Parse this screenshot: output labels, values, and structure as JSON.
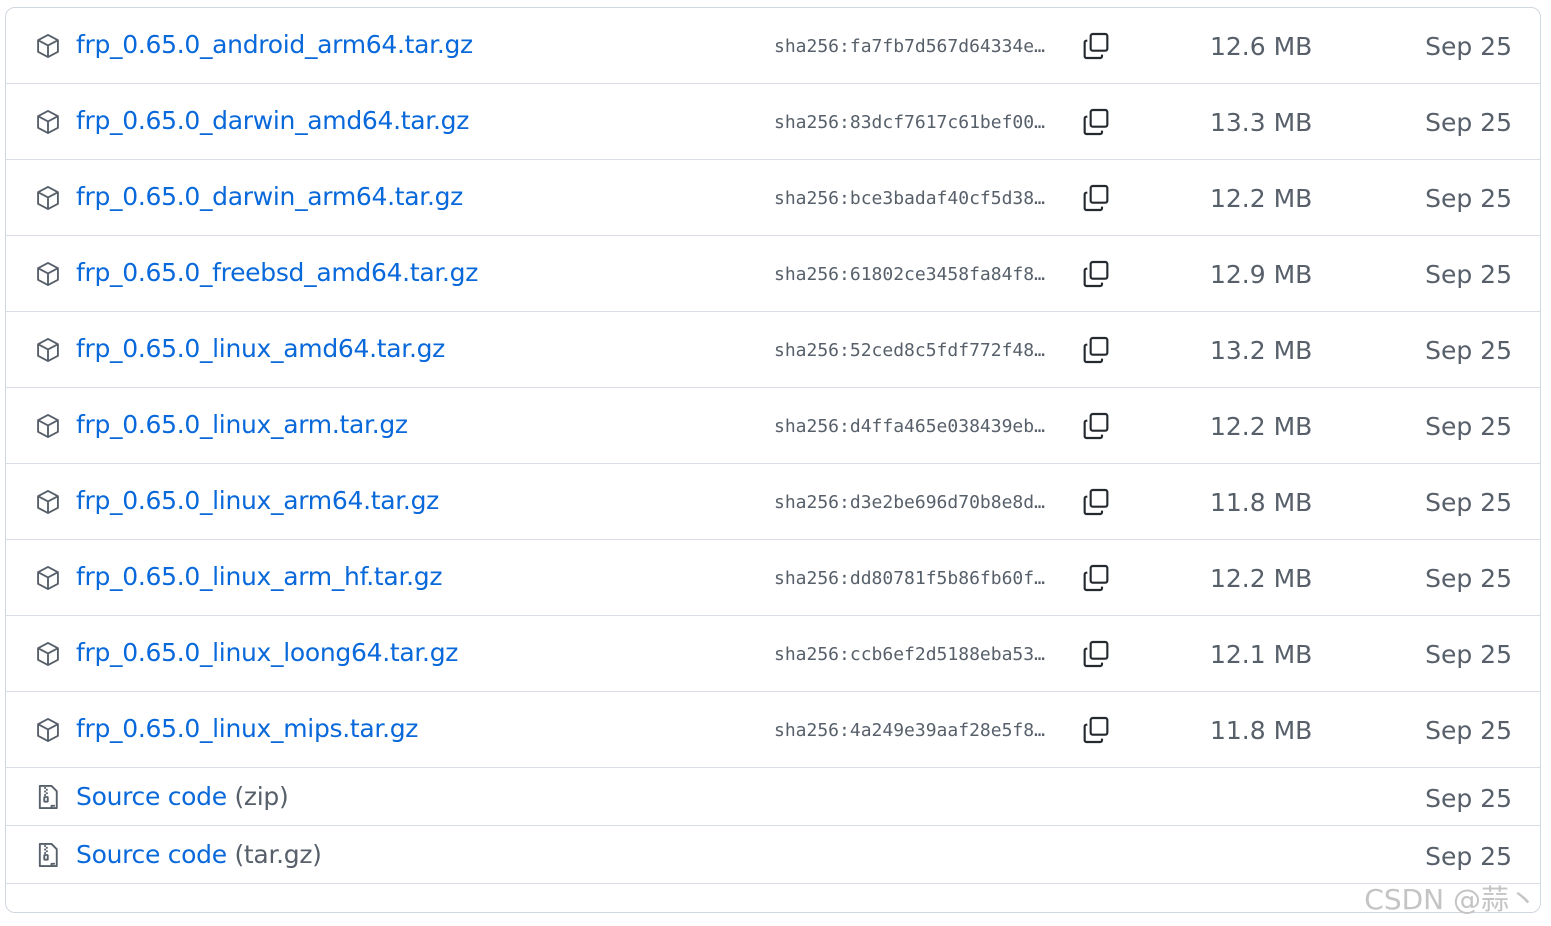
{
  "assets": [
    {
      "name": "frp_0.65.0_android_arm64.tar.gz",
      "digest": "sha256:fa7fb7d567d64334e…",
      "size": "12.6 MB",
      "date": "Sep 25"
    },
    {
      "name": "frp_0.65.0_darwin_amd64.tar.gz",
      "digest": "sha256:83dcf7617c61bef00…",
      "size": "13.3 MB",
      "date": "Sep 25"
    },
    {
      "name": "frp_0.65.0_darwin_arm64.tar.gz",
      "digest": "sha256:bce3badaf40cf5d38…",
      "size": "12.2 MB",
      "date": "Sep 25"
    },
    {
      "name": "frp_0.65.0_freebsd_amd64.tar.gz",
      "digest": "sha256:61802ce3458fa84f8…",
      "size": "12.9 MB",
      "date": "Sep 25"
    },
    {
      "name": "frp_0.65.0_linux_amd64.tar.gz",
      "digest": "sha256:52ced8c5fdf772f48…",
      "size": "13.2 MB",
      "date": "Sep 25"
    },
    {
      "name": "frp_0.65.0_linux_arm.tar.gz",
      "digest": "sha256:d4ffa465e038439eb…",
      "size": "12.2 MB",
      "date": "Sep 25"
    },
    {
      "name": "frp_0.65.0_linux_arm64.tar.gz",
      "digest": "sha256:d3e2be696d70b8e8d…",
      "size": "11.8 MB",
      "date": "Sep 25"
    },
    {
      "name": "frp_0.65.0_linux_arm_hf.tar.gz",
      "digest": "sha256:dd80781f5b86fb60f…",
      "size": "12.2 MB",
      "date": "Sep 25"
    },
    {
      "name": "frp_0.65.0_linux_loong64.tar.gz",
      "digest": "sha256:ccb6ef2d5188eba53…",
      "size": "12.1 MB",
      "date": "Sep 25"
    },
    {
      "name": "frp_0.65.0_linux_mips.tar.gz",
      "digest": "sha256:4a249e39aaf28e5f8…",
      "size": "11.8 MB",
      "date": "Sep 25"
    }
  ],
  "source_code": [
    {
      "label": "Source code",
      "suffix": "(zip)",
      "date": "Sep 25"
    },
    {
      "label": "Source code",
      "suffix": "(tar.gz)",
      "date": "Sep 25"
    }
  ],
  "watermark": "CSDN @蒜丶",
  "icons": {
    "asset": "package-icon",
    "source": "file-zip-icon",
    "copy": "copy-icon"
  },
  "colors": {
    "link": "#0969da",
    "muted": "#57606a",
    "border": "#d0d7de"
  }
}
